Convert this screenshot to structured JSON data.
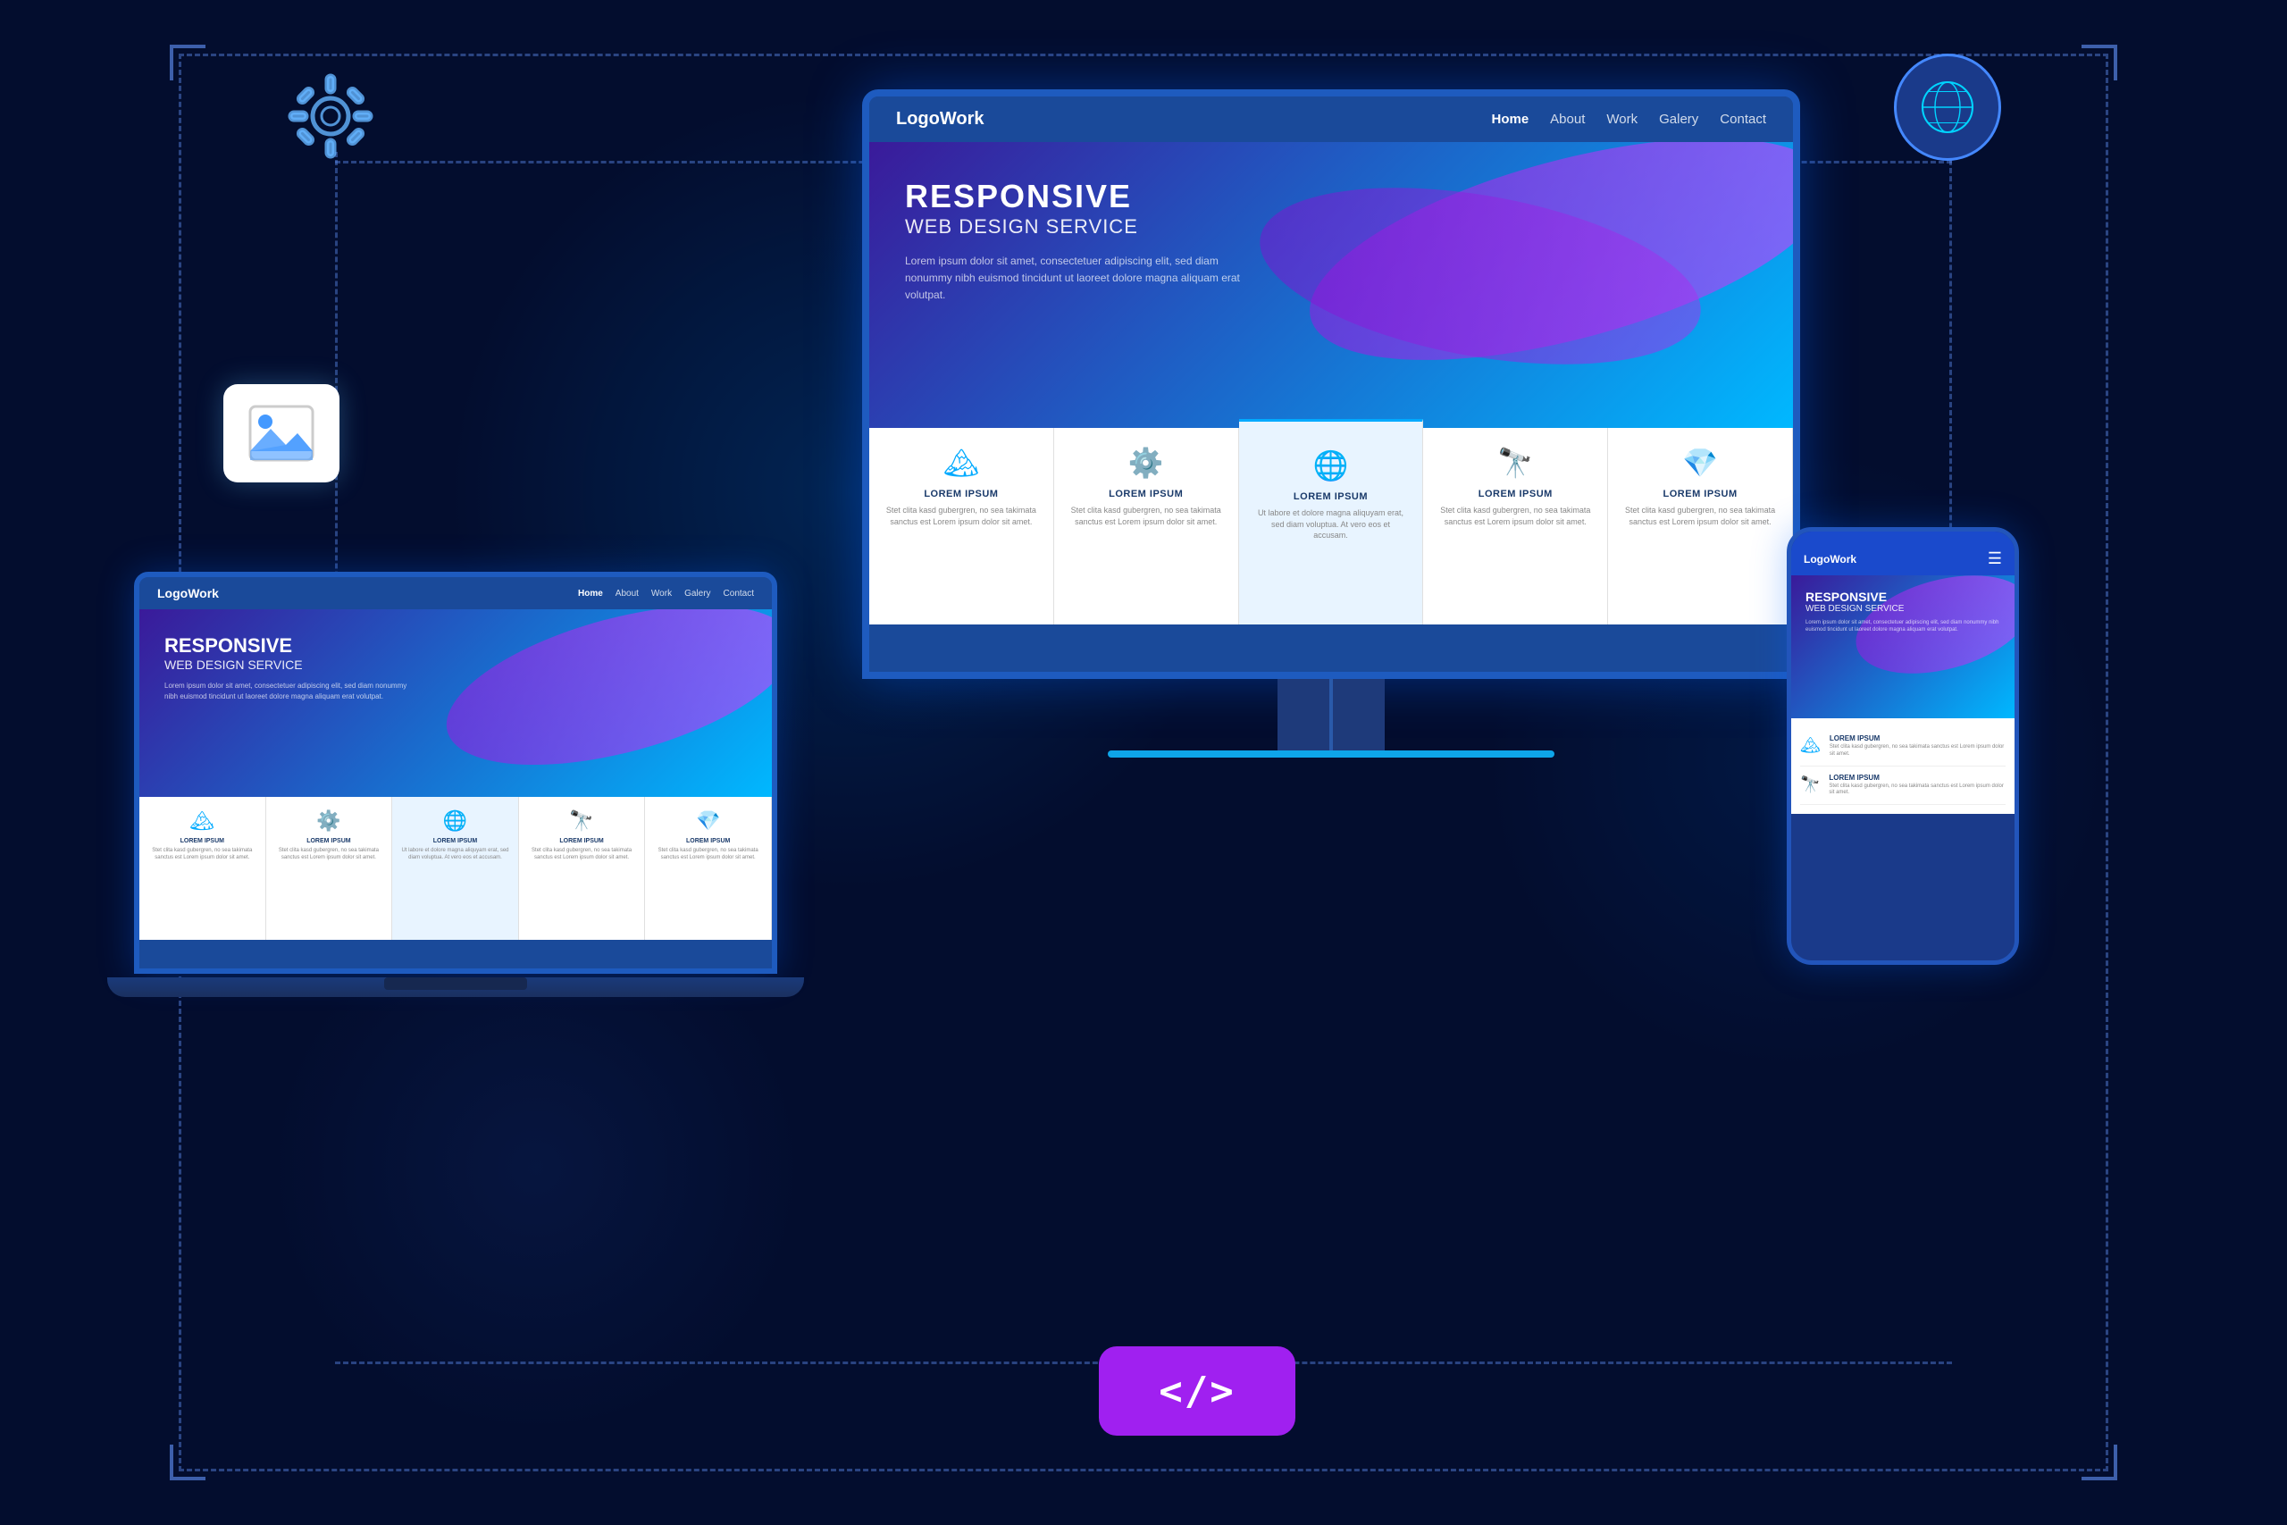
{
  "background": {
    "color": "#030d2e"
  },
  "site": {
    "logo": "LogoWork",
    "nav": {
      "home": "Home",
      "about": "About",
      "work": "Work",
      "gallery": "Galery",
      "contact": "Contact"
    },
    "hero": {
      "title": "RESPONSIVE",
      "subtitle": "WEB DESIGN SERVICE",
      "description": "Lorem ipsum dolor sit amet, consectetuer adipiscing elit, sed diam nonummy nibh euismod tincidunt ut laoreet dolore magna aliquam erat volutpat."
    },
    "services": [
      {
        "icon": "🏔",
        "title": "LOREM IPSUM",
        "desc": "Stet clita kasd gubergren, no sea takimata sanctus est Lorem ipsum dolor sit amet."
      },
      {
        "icon": "⚙",
        "title": "LOREM IPSUM",
        "desc": "Stet clita kasd gubergren, no sea takimata sanctus est Lorem ipsum dolor sit amet."
      },
      {
        "icon": "🌐",
        "title": "LOREM IPSUM",
        "desc": "Ut labore et dolore magna aliquyam erat, sed diam voluptua. At vero eos et accusam."
      },
      {
        "icon": "🔭",
        "title": "LOREM IPSUM",
        "desc": "Stet clita kasd gubergren, no sea takimata sanctus est Lorem ipsum dolor sit amet."
      },
      {
        "icon": "💎",
        "title": "LOREM IPSUM",
        "desc": "Stet clita kasd gubergren, no sea takimata sanctus est Lorem ipsum dolor sit amet."
      }
    ]
  },
  "icons": {
    "gear": "gear-icon",
    "globe": "globe-icon",
    "image": "image-placeholder-icon",
    "code": "</>",
    "code_label": "code-icon"
  }
}
